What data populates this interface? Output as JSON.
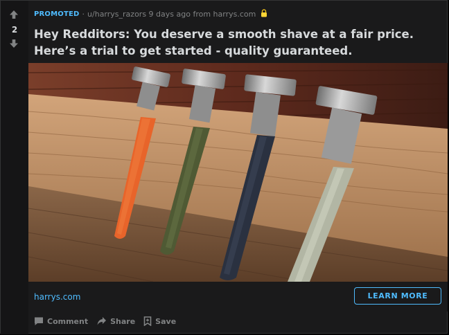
{
  "vote": {
    "score": "2"
  },
  "meta": {
    "promoted": "PROMOTED",
    "separator": "·",
    "byline": "u/harrys_razors 9 days ago from harrys.com"
  },
  "post": {
    "title": "Hey Redditors: You deserve a smooth shave at a fair price. Here’s a trial to get started - quality guaranteed."
  },
  "link": {
    "domain": "harrys.com",
    "cta": "LEARN MORE"
  },
  "actions": {
    "comment": "Comment",
    "share": "Share",
    "save": "Save"
  },
  "colors": {
    "accent": "#4fbcff",
    "card": "#1a1a1b",
    "text": "#d7dadc",
    "muted": "#818384"
  }
}
